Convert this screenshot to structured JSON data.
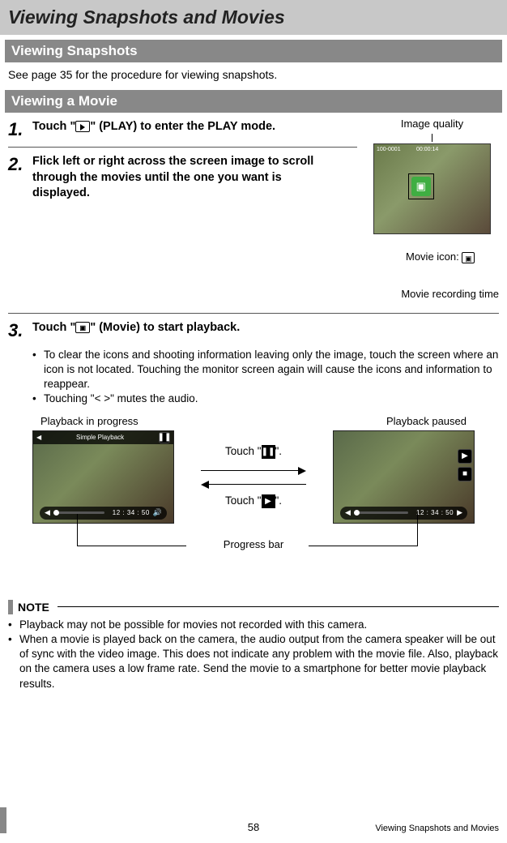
{
  "title": "Viewing Snapshots and Movies",
  "sections": {
    "snapshots_header": "Viewing Snapshots",
    "snapshots_text": "See page 35 for the procedure for viewing snapshots.",
    "movie_header": "Viewing a Movie"
  },
  "steps": {
    "s1": {
      "num": "1.",
      "before": "Touch \"",
      "after": "\" (PLAY) to enter the PLAY mode."
    },
    "s2": {
      "num": "2.",
      "text": "Flick left or right across the screen image to scroll through the movies until the one you want is displayed."
    },
    "s3": {
      "num": "3.",
      "before": "Touch \"",
      "after": "\" (Movie) to start playback.",
      "bullets": [
        "To clear the icons and shooting information leaving only the image, touch the screen where an icon is not located. Touching the monitor screen again will cause the icons and information to reappear.",
        "Touching \"< >\" mutes the audio."
      ]
    }
  },
  "annotations": {
    "image_quality": "Image quality",
    "movie_icon_label": "Movie icon: ",
    "movie_recording_time": "Movie recording time"
  },
  "playback": {
    "left_label": "Playback in progress",
    "right_label": "Playback paused",
    "header_text": "Simple Playback",
    "time_display": "12 : 34 : 50",
    "touch_prefix": "Touch \"",
    "touch_suffix": "\".",
    "progress_bar_label": "Progress bar"
  },
  "note": {
    "title": "NOTE",
    "items": [
      "Playback may not be possible for movies not recorded with this camera.",
      "When a movie is played back on the camera, the audio output from the camera speaker will be out of sync with the video image. This does not indicate any problem with the movie file. Also, playback on the camera uses a low frame rate. Send the movie to a smartphone for better movie playback results."
    ]
  },
  "footer": {
    "page": "58",
    "right": "Viewing Snapshots and Movies"
  }
}
